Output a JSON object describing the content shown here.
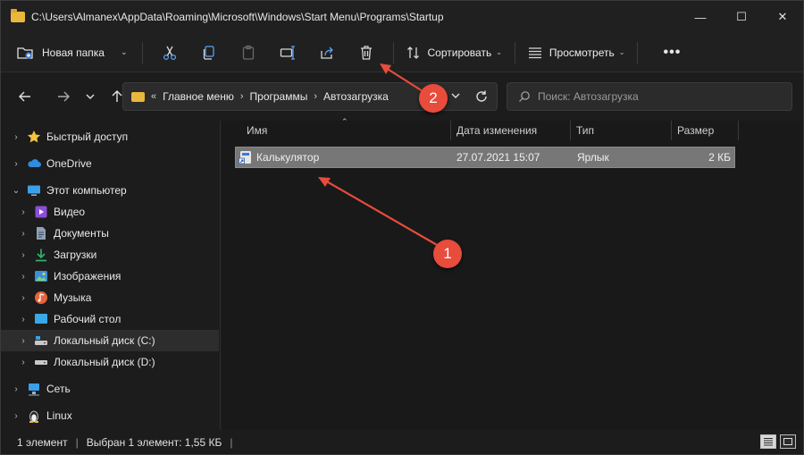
{
  "window": {
    "title": "C:\\Users\\Almanex\\AppData\\Roaming\\Microsoft\\Windows\\Start Menu\\Programs\\Startup",
    "minimize": "—",
    "maximize": "☐",
    "close": "✕"
  },
  "toolbar": {
    "new_folder_label": "Новая папка",
    "sort_label": "Сортировать",
    "view_label": "Просмотреть",
    "more_label": "•••",
    "icons": [
      "scissors-icon",
      "copy-icon",
      "paste-icon",
      "rename-icon",
      "share-icon",
      "delete-icon"
    ]
  },
  "address": {
    "overflow": "«",
    "crumbs": [
      "Главное меню",
      "Программы",
      "Автозагрузка"
    ],
    "search_placeholder": "Поиск: Автозагрузка"
  },
  "nav": {
    "items": [
      {
        "label": "Быстрый доступ",
        "icon": "star-icon"
      },
      {
        "label": "OneDrive",
        "icon": "cloud-icon"
      },
      {
        "label": "Этот компьютер",
        "icon": "computer-icon"
      },
      {
        "label": "Видео",
        "icon": "video-icon"
      },
      {
        "label": "Документы",
        "icon": "documents-icon"
      },
      {
        "label": "Загрузки",
        "icon": "download-icon"
      },
      {
        "label": "Изображения",
        "icon": "pictures-icon"
      },
      {
        "label": "Музыка",
        "icon": "music-icon"
      },
      {
        "label": "Рабочий стол",
        "icon": "desktop-icon"
      },
      {
        "label": "Локальный диск (C:)",
        "icon": "drive-icon"
      },
      {
        "label": "Локальный диск (D:)",
        "icon": "drive-icon"
      },
      {
        "label": "Сеть",
        "icon": "network-icon"
      },
      {
        "label": "Linux",
        "icon": "linux-icon"
      }
    ],
    "selected": "Локальный диск (C:)"
  },
  "filelist": {
    "columns": [
      "Имя",
      "Дата изменения",
      "Тип",
      "Размер"
    ],
    "rows": [
      {
        "name": "Калькулятор",
        "date": "27.07.2021 15:07",
        "type": "Ярлык",
        "size": "2 КБ"
      }
    ]
  },
  "status": {
    "count": "1 элемент",
    "selection": "Выбран 1 элемент: 1,55 КБ"
  },
  "annotations": {
    "badge1": "1",
    "badge2": "2",
    "color": "#e74c3c"
  }
}
